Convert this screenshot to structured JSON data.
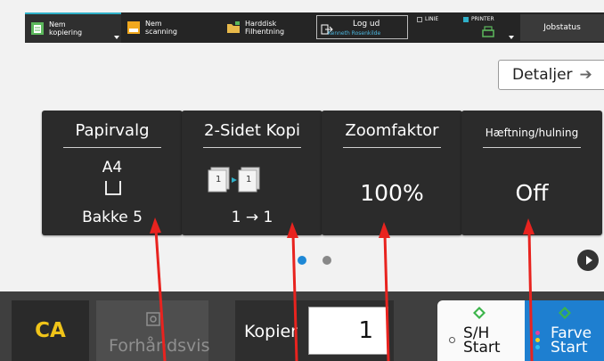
{
  "topbar": {
    "tabs": [
      {
        "line1": "Nem",
        "line2": "kopiering",
        "icon": "copy-icon"
      },
      {
        "line1": "Nem",
        "line2": "scanning",
        "icon": "scan-icon"
      },
      {
        "line1": "Harddisk",
        "line2": "Filhentning",
        "icon": "folder-icon"
      }
    ],
    "logout": {
      "label": "Log ud",
      "user": "Kenneth Rosenkilde",
      "icon": "logout-icon"
    },
    "indicators": {
      "line": "LINIE",
      "printer": "PRINTER"
    },
    "jobstatus": "Jobstatus"
  },
  "details_button": {
    "label": "Detaljer",
    "arrow": "➔"
  },
  "tiles": [
    {
      "title": "Papirvalg",
      "lines": [
        "A4",
        "Bakke 5"
      ],
      "icon": "paper-tray-icon"
    },
    {
      "title": "2-Sidet Kopi",
      "value": "1 → 1",
      "icon": "duplex-icon"
    },
    {
      "title": "Zoomfaktor",
      "value": "100%"
    },
    {
      "title": "Hæftning/hulning",
      "value": "Off"
    }
  ],
  "pager": {
    "page_count": 2,
    "current_page": 1
  },
  "bottombar": {
    "ca": "CA",
    "preview": "Forhåndsvis",
    "copies_label": "Kopier",
    "copies_value": "1",
    "bw_start": [
      "S/H",
      "Start"
    ],
    "color_start": [
      "Farve",
      "Start"
    ]
  },
  "colors": {
    "accent_teal": "#2fb0c8",
    "ca_yellow": "#f0c419",
    "color_start_blue": "#1e7fd0",
    "annotation_red": "#e8231f",
    "active_dot": "#1e88d6"
  }
}
